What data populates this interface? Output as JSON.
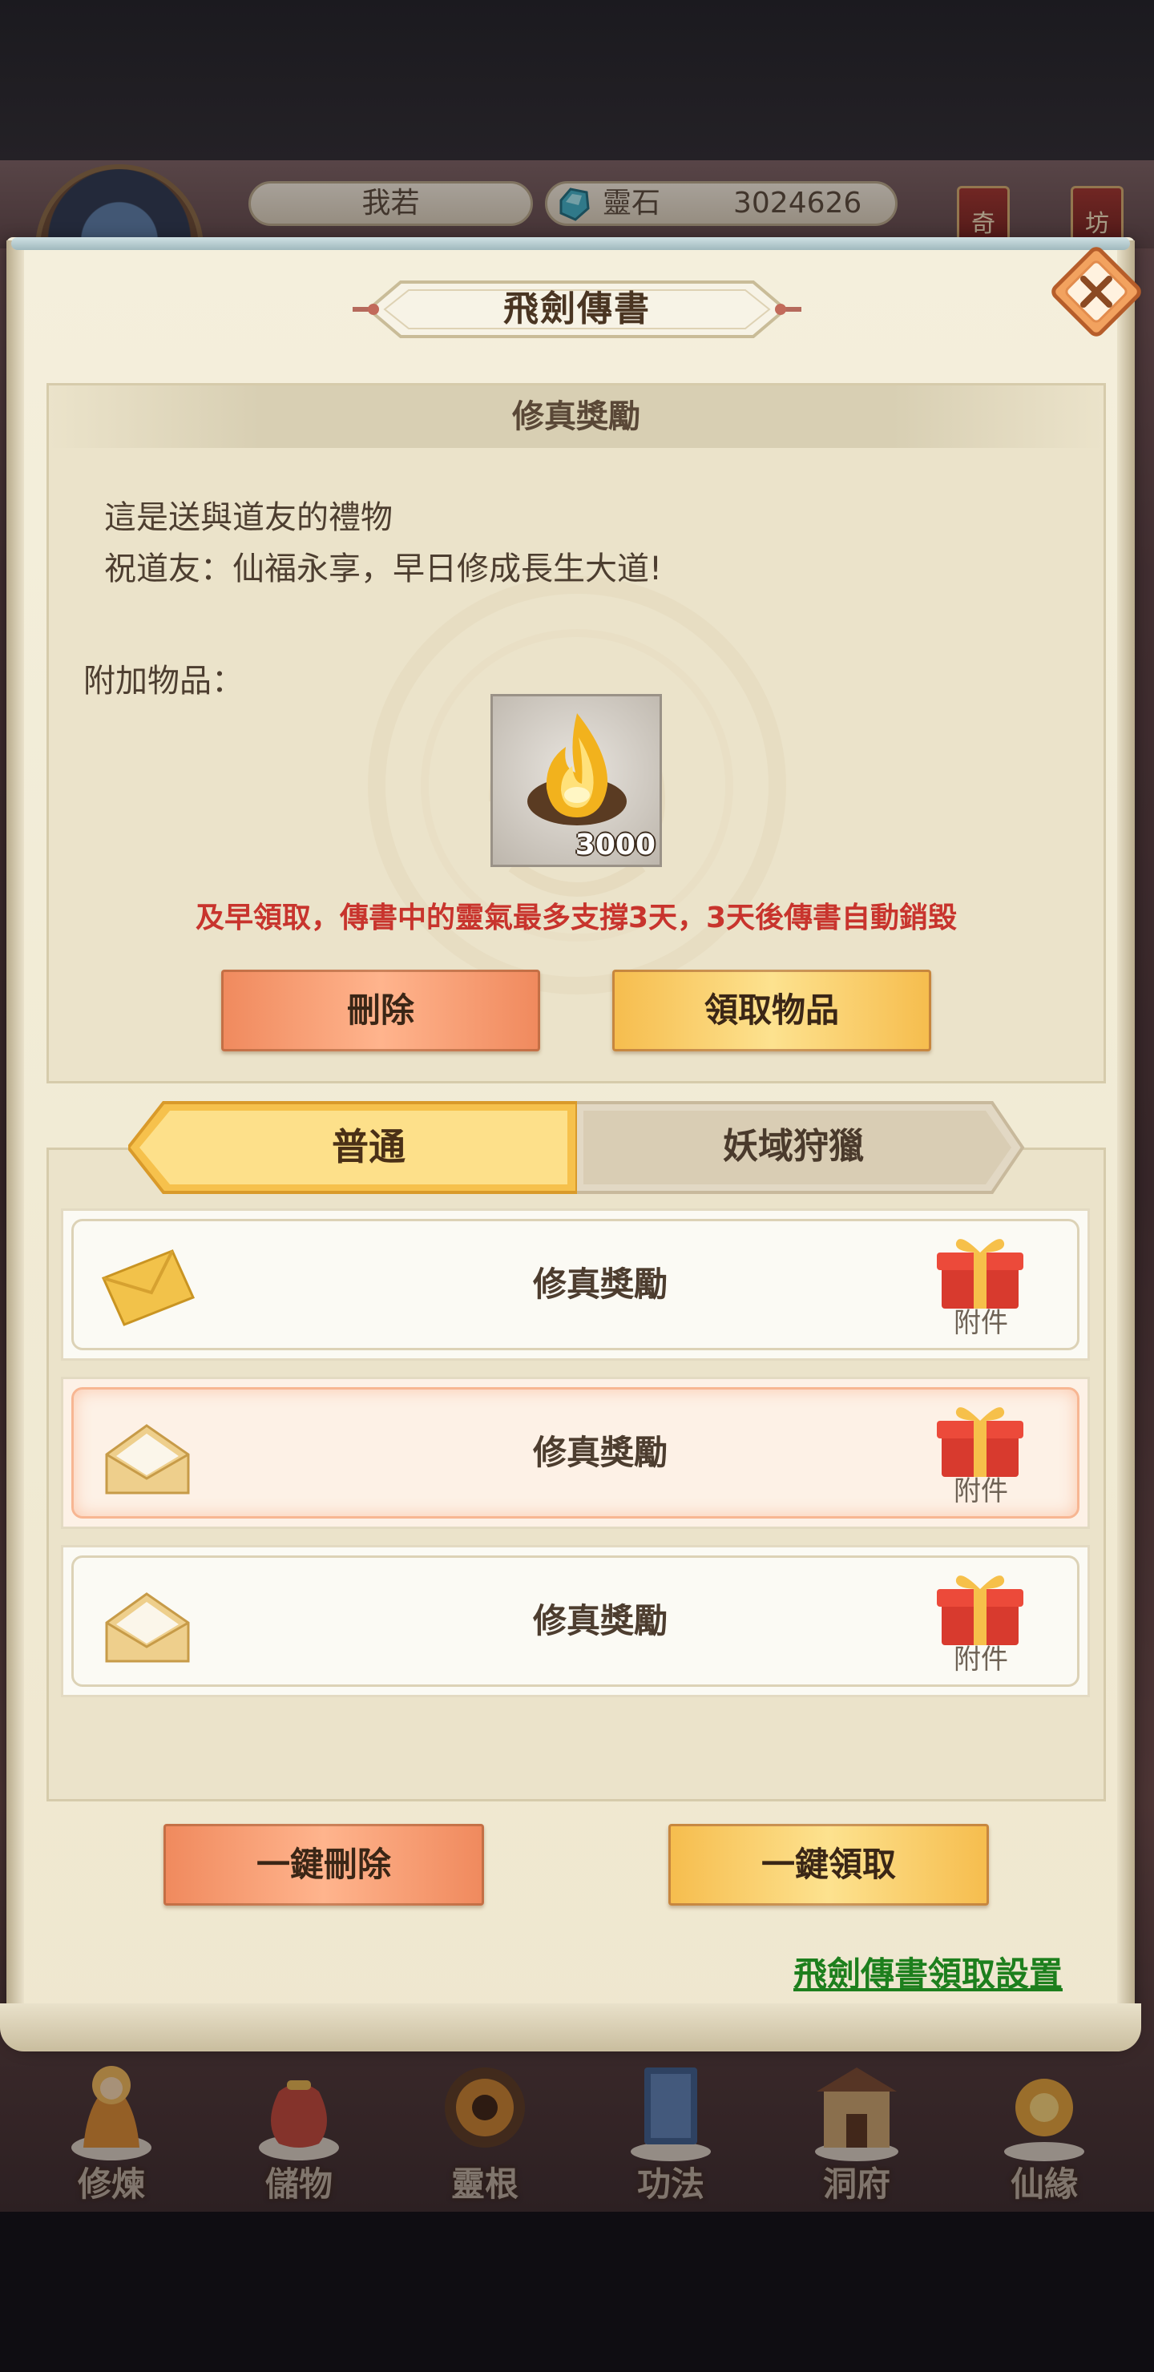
{
  "hud": {
    "player_name": "我若",
    "stone_label": "靈石",
    "stone_value": "3024626",
    "tag_left": "奇",
    "tag_right": "坊"
  },
  "modal": {
    "title": "飛劍傳書",
    "detail": {
      "header": "修真獎勵",
      "line1": "這是送與道友的禮物",
      "line2": "祝道友：仙福永享，早日修成長生大道!",
      "attach_label": "附加物品：",
      "attachment": {
        "icon": "spirit-flame-icon",
        "quantity": "3000"
      },
      "warning": "及早領取，傳書中的靈氣最多支撐3天，3天後傳書自動銷毀",
      "delete_label": "刪除",
      "claim_label": "領取物品"
    },
    "tabs": [
      {
        "label": "普通",
        "active": true
      },
      {
        "label": "妖域狩獵",
        "active": false
      }
    ],
    "mails": [
      {
        "title": "修真獎勵",
        "state": "unread",
        "attachment_label": "附件",
        "selected": false
      },
      {
        "title": "修真獎勵",
        "state": "read",
        "attachment_label": "附件",
        "selected": true
      },
      {
        "title": "修真獎勵",
        "state": "read",
        "attachment_label": "附件",
        "selected": false
      }
    ],
    "delete_all_label": "一鍵刪除",
    "claim_all_label": "一鍵領取",
    "settings_link": "飛劍傳書領取設置"
  },
  "nav": [
    {
      "label": "修煉",
      "icon": "cultivation-icon"
    },
    {
      "label": "儲物",
      "icon": "storage-bag-icon"
    },
    {
      "label": "靈根",
      "icon": "spirit-root-icon"
    },
    {
      "label": "功法",
      "icon": "technique-book-icon"
    },
    {
      "label": "洞府",
      "icon": "cave-dwelling-icon"
    },
    {
      "label": "仙緣",
      "icon": "fortune-icon"
    }
  ],
  "colors": {
    "warning": "#c8342d",
    "link": "#1d7f1d",
    "button_red": "#f08a5e",
    "button_gold": "#f6bd4e"
  }
}
